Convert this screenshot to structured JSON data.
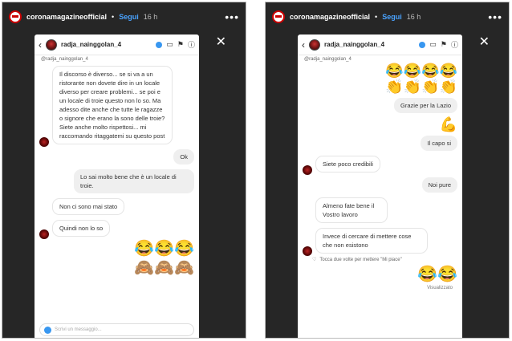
{
  "left": {
    "story_user": "coronamagazineofficial",
    "follow": "Segui",
    "time": "16 h",
    "dm_name": "radja_nainggolan_4",
    "handle": "@radja_nainggolan_4",
    "messages": [
      {
        "side": "in",
        "text": "Il discorso è diverso... se si va a un ristorante non dovete dire in un locale diverso per creare problemi... se poi e un locale di troie questo non lo so. Ma adesso dite anche che tutte le ragazze o signore che erano la sono delle troie? Siete anche molto rispettosi... mi raccomando ritaggatemi su questo post"
      },
      {
        "side": "out",
        "text": "Ok"
      },
      {
        "side": "out",
        "text": "Lo sai molto bene che è un locale di troie."
      },
      {
        "side": "in",
        "text": "Non ci sono mai stato"
      },
      {
        "side": "in",
        "text": "Quindi non lo so"
      }
    ],
    "emoji_row1": "😂😂😂",
    "emoji_row2": "🙈🙈🙈",
    "input_placeholder": "Scrivi un messaggio..."
  },
  "right": {
    "story_user": "coronamagazineofficial",
    "follow": "Segui",
    "time": "16 h",
    "dm_name": "radja_nainggolan_4",
    "handle": "@radja_nainggolan_4",
    "emoji_top1": "😂😂😂😂",
    "emoji_top2": "👏👏👏👏",
    "messages": [
      {
        "side": "out",
        "text": "Grazie per la Lazio"
      },
      {
        "side": "emoji",
        "text": "💪"
      },
      {
        "side": "out",
        "text": "Il capo si"
      },
      {
        "side": "in",
        "text": "Siete poco credibili"
      },
      {
        "side": "out",
        "text": "Noi pure"
      },
      {
        "side": "in",
        "text": "Almeno fate bene il Vostro lavoro"
      },
      {
        "side": "in",
        "text": "Invece di cercare di mettere cose che non esistono"
      }
    ],
    "heart_hint": "Tocca due volte per mettere \"Mi piace\"",
    "emoji_bottom": "😂😂",
    "seen": "Visualizzato"
  }
}
